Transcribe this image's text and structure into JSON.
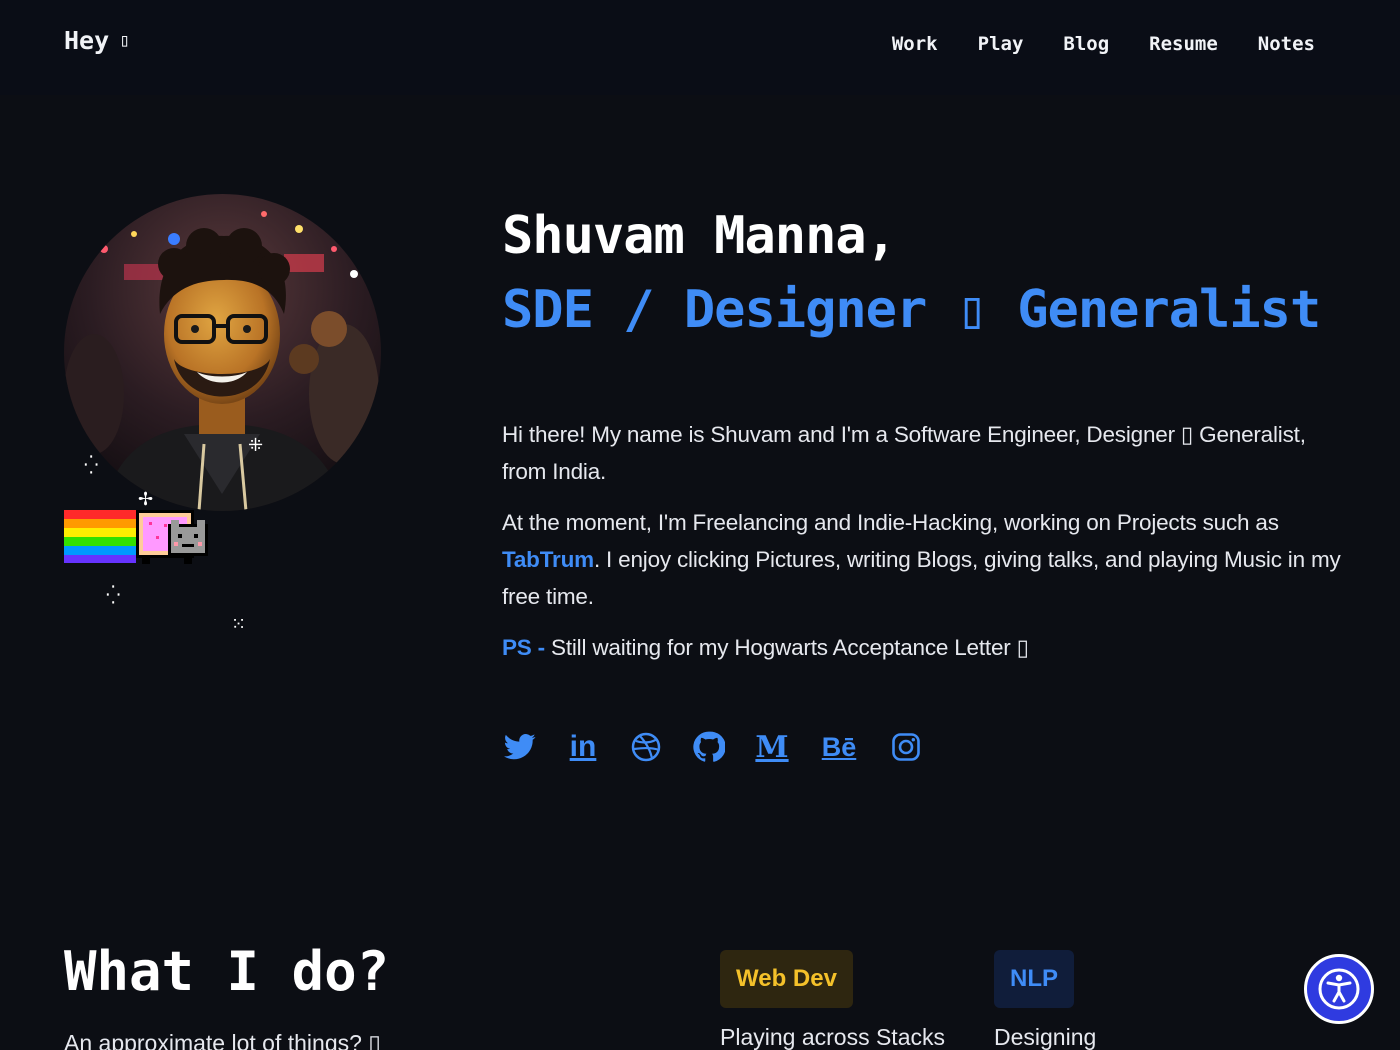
{
  "header": {
    "brand": "Hey",
    "brand_glyph": "▯",
    "nav": [
      "Work",
      "Play",
      "Blog",
      "Resume",
      "Notes"
    ]
  },
  "hero": {
    "name": "Shuvam Manna,",
    "role": "SDE / Designer ▯ Generalist",
    "bio": {
      "p1": "Hi there! My name is Shuvam and I'm a Software Engineer, Designer ▯ Generalist, from India.",
      "p2_before": "At the moment, I'm Freelancing and Indie-Hacking, working on Projects such as ",
      "p2_link": "TabTrum",
      "p2_after": ". I enjoy clicking Pictures, writing Blogs, giving talks, and playing Music in my free time.",
      "p3_label": "PS -",
      "p3_text": " Still waiting for my Hogwarts Acceptance Letter ▯"
    }
  },
  "socials": [
    {
      "name": "twitter-icon",
      "text": ""
    },
    {
      "name": "linkedin-icon",
      "text": "in"
    },
    {
      "name": "dribbble-icon",
      "text": ""
    },
    {
      "name": "github-icon",
      "text": ""
    },
    {
      "name": "medium-icon",
      "text": "M"
    },
    {
      "name": "behance-icon",
      "text": "Bē"
    },
    {
      "name": "instagram-icon",
      "text": ""
    }
  ],
  "what_i_do": {
    "title": "What I do?",
    "subtitle": "An approximate lot of things? ▯",
    "tags": [
      {
        "label": "Web Dev",
        "desc": "Playing across Stacks"
      },
      {
        "label": "NLP",
        "desc": "Designing"
      }
    ]
  },
  "colors": {
    "background": "#0c0e14",
    "accent": "#3f8cf6",
    "web_dev_tag": "#f4c12a",
    "accessibility": "#2f3be0"
  }
}
